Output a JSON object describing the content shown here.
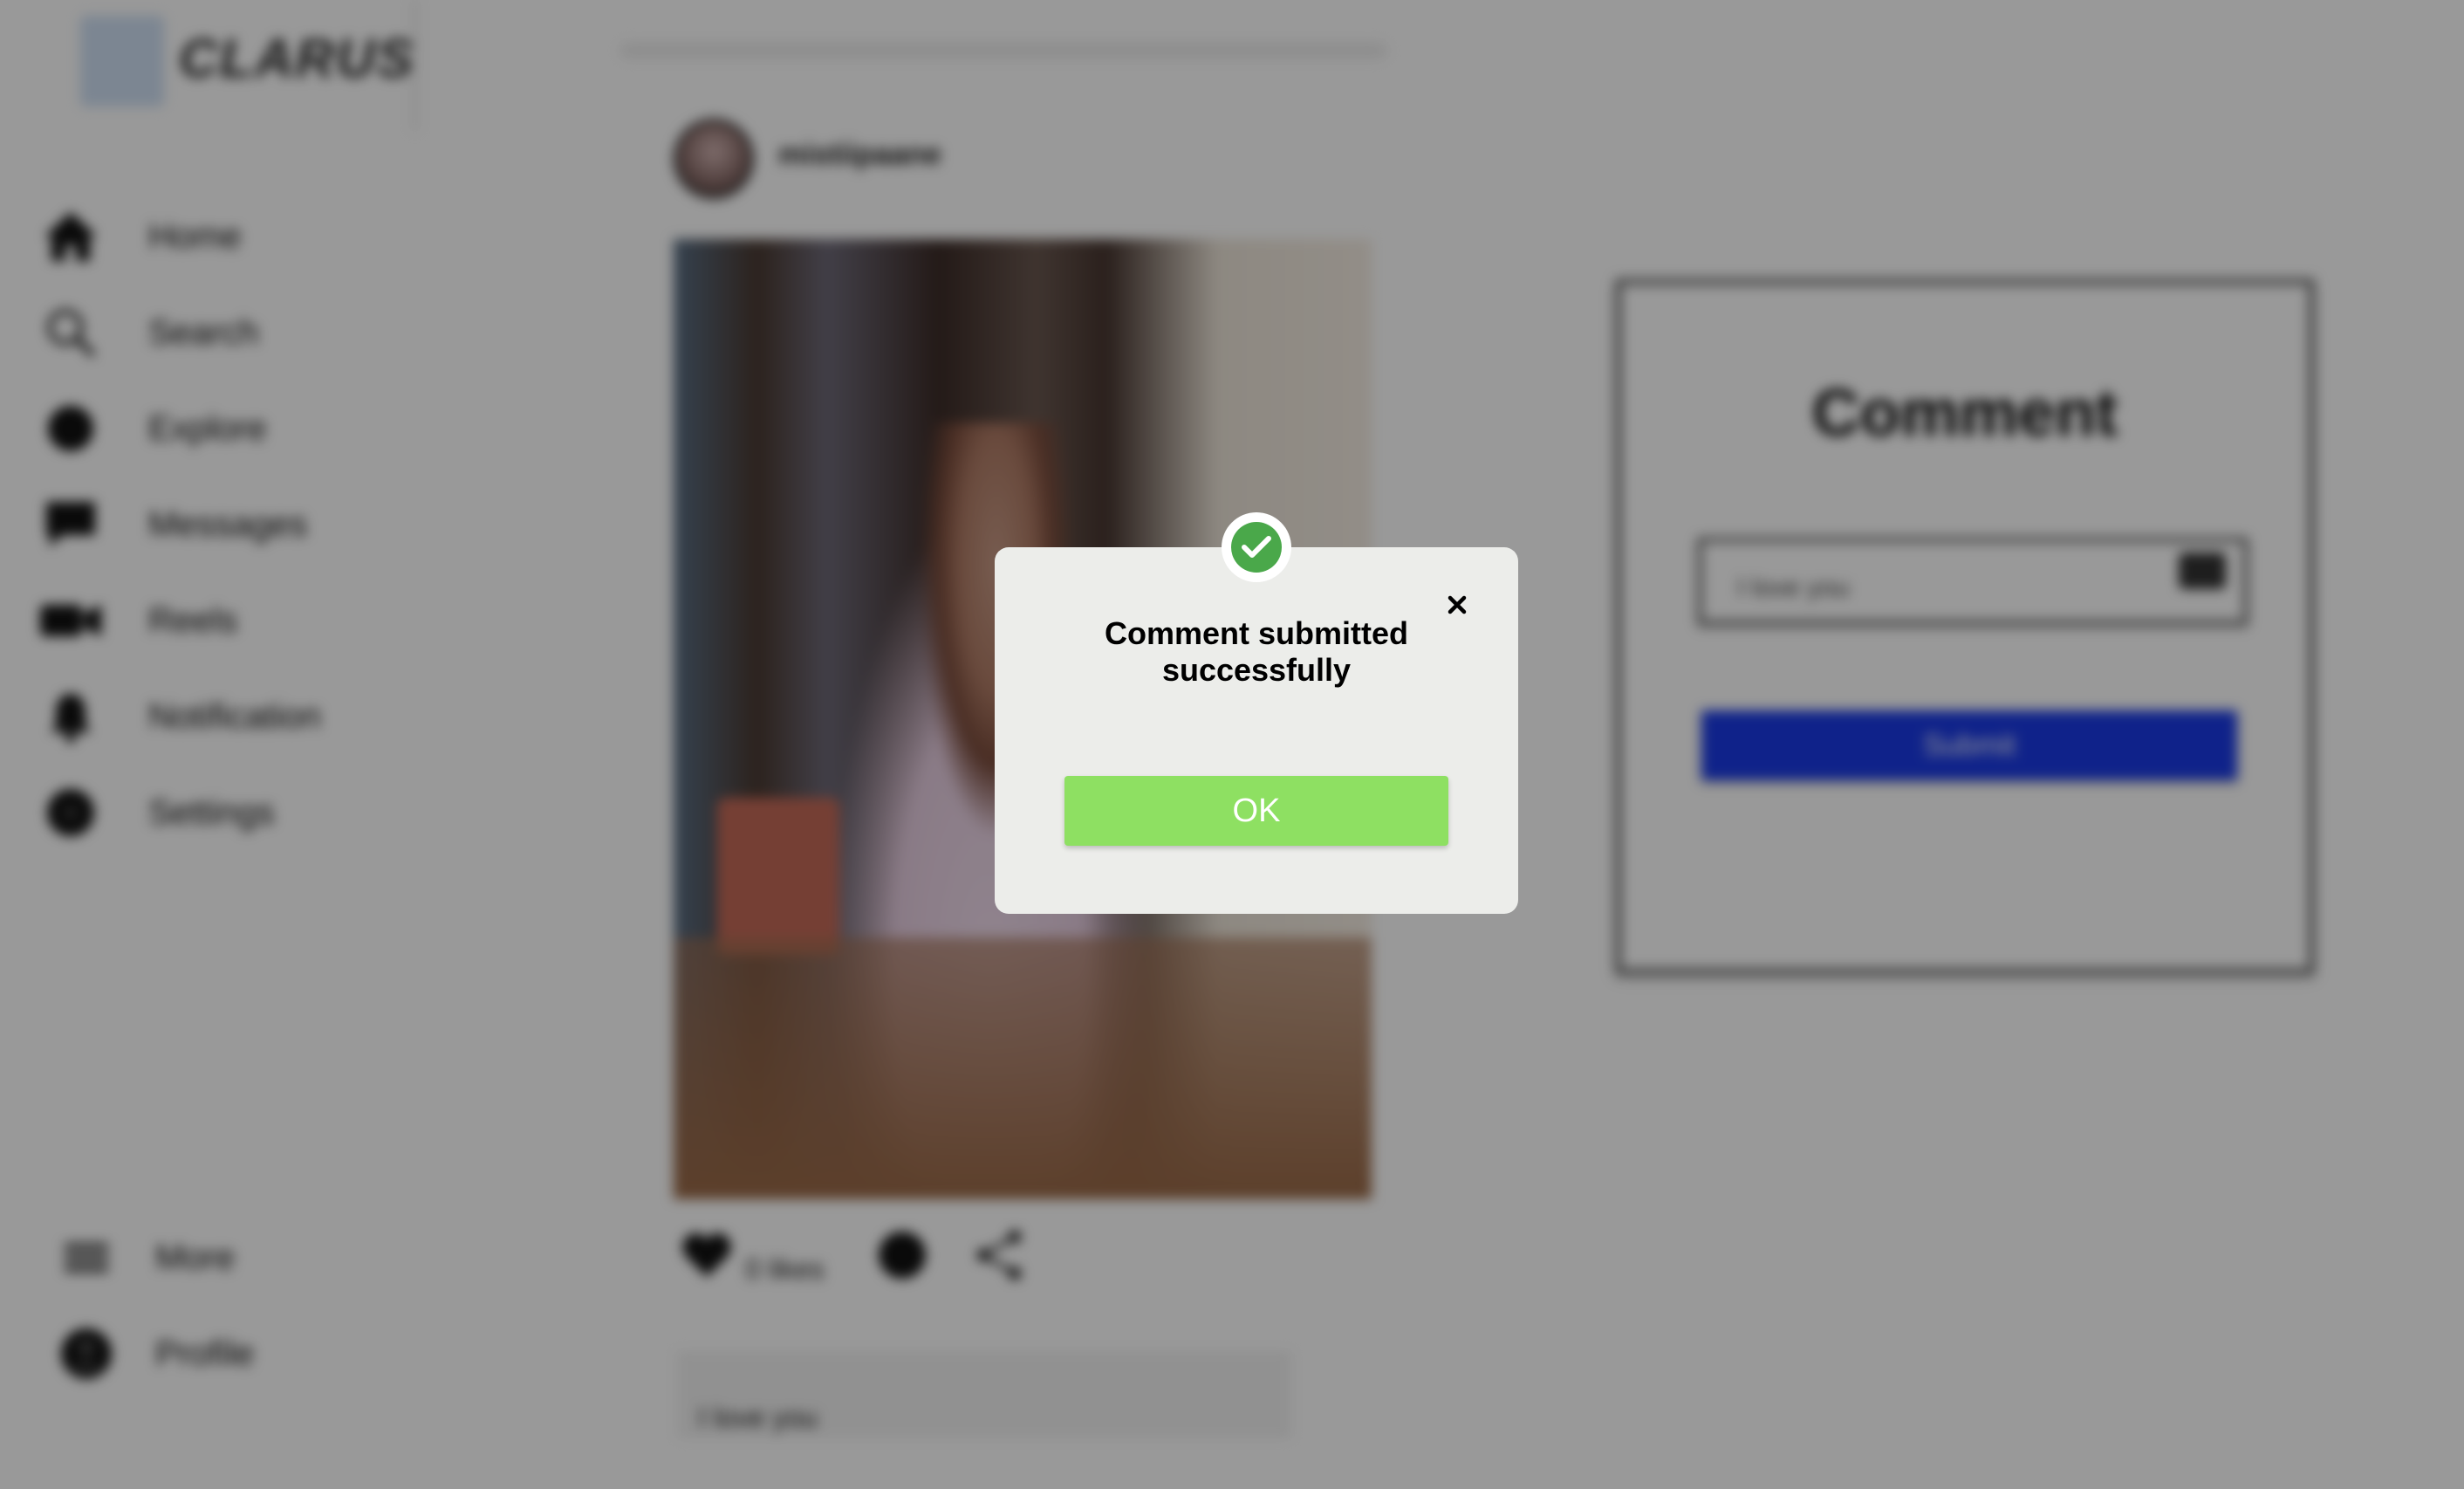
{
  "brand": {
    "name": "CLARUS"
  },
  "sidebar": {
    "items": [
      {
        "label": "Home",
        "icon": "home-icon"
      },
      {
        "label": "Search",
        "icon": "search-icon"
      },
      {
        "label": "Explore",
        "icon": "explore-icon"
      },
      {
        "label": "Messages",
        "icon": "messages-icon"
      },
      {
        "label": "Reels",
        "icon": "reels-icon"
      },
      {
        "label": "Notification",
        "icon": "bell-icon"
      },
      {
        "label": "Settings",
        "icon": "gear-icon"
      }
    ],
    "bottom_items": [
      {
        "label": "More",
        "icon": "menu-icon"
      },
      {
        "label": "Profile",
        "icon": "profile-icon"
      }
    ]
  },
  "post": {
    "username": "mistiipaane",
    "likes": "0 likes",
    "comment_preview": "I love you"
  },
  "comment_panel": {
    "title": "Comment",
    "input_value": "I love you",
    "submit_label": "Submit"
  },
  "modal": {
    "message": "Comment submitted successfully",
    "ok_label": "OK",
    "status_color": "#4aa84a",
    "ok_color": "#8ee062"
  }
}
